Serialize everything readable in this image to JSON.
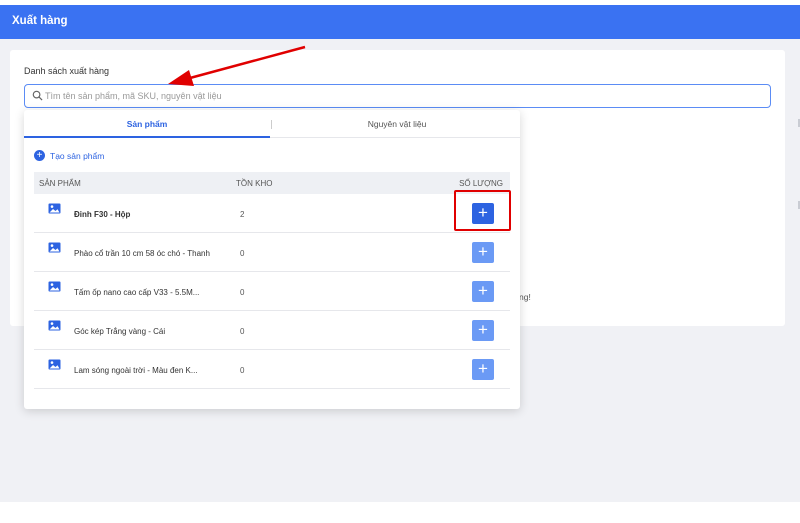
{
  "header": {
    "title": "Xuất hàng"
  },
  "card": {
    "section_label": "Danh sách xuất hàng"
  },
  "search": {
    "placeholder": "Tìm tên sản phẩm, mã SKU, nguyên vật liệu",
    "value": ""
  },
  "dropdown": {
    "tabs": [
      {
        "label": "Sản phẩm",
        "active": true
      },
      {
        "label": "Nguyên vật liệu",
        "active": false
      }
    ],
    "create_label": "Tạo sản phẩm",
    "columns": [
      "SẢN PHẨM",
      "TỒN KHO",
      "SỐ LƯỢNG"
    ],
    "rows": [
      {
        "name": "Đinh F30 - Hộp",
        "stock": "2"
      },
      {
        "name": "Phào cổ trần 10 cm 58 óc chó - Thanh",
        "stock": "0"
      },
      {
        "name": "Tấm ốp nano cao cấp V33 - 5.5M...",
        "stock": "0"
      },
      {
        "name": "Góc kép Trắng vàng - Cái",
        "stock": "0"
      },
      {
        "name": "Lam sóng ngoài trời - Màu đen K...",
        "stock": "0"
      }
    ]
  },
  "partial_text": "ng!",
  "icons": {
    "search": "search-icon",
    "plus": "plus-icon",
    "image": "image-placeholder-icon"
  },
  "colors": {
    "header": "#3a72f2",
    "primary": "#2d63e1",
    "highlight": "#e00000"
  }
}
